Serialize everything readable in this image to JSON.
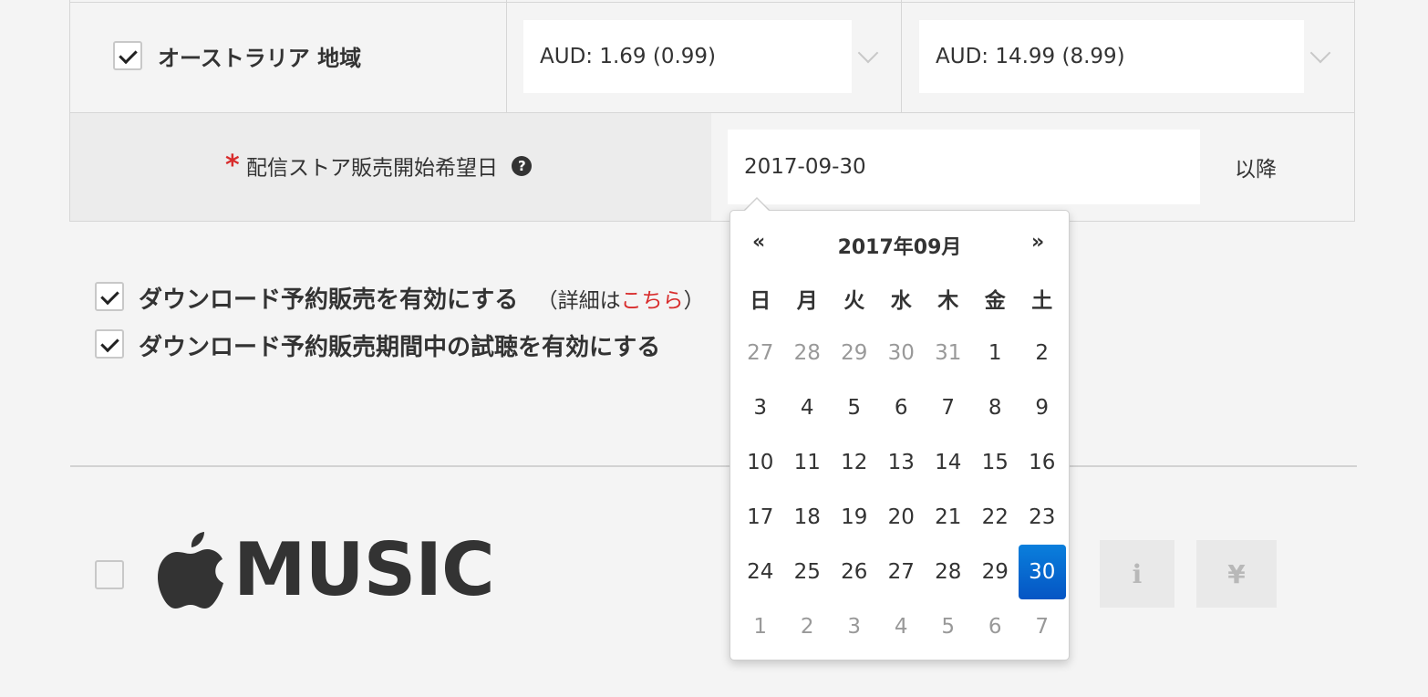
{
  "region_row": {
    "checked": true,
    "label": "オーストラリア 地域",
    "select1_value": "AUD: 1.69 (0.99)",
    "select2_value": "AUD: 14.99 (8.99)"
  },
  "release_date_row": {
    "required_mark": "*",
    "label": "配信ストア販売開始希望日",
    "help_icon_glyph": "?",
    "date_value": "2017-09-30",
    "suffix": "以降"
  },
  "preorder": {
    "option1_label": "ダウンロード予約販売を有効にする",
    "option1_note_prefix": "（詳細は",
    "option1_note_link": "こちら",
    "option1_note_suffix": "）",
    "option2_label": "ダウンロード予約販売期間中の試聴を有効にする"
  },
  "calendar": {
    "prev": "«",
    "next": "»",
    "title": "2017年09月",
    "weekdays": [
      "日",
      "月",
      "火",
      "水",
      "木",
      "金",
      "土"
    ],
    "weeks": [
      [
        "27",
        "28",
        "29",
        "30",
        "31",
        "1",
        "2"
      ],
      [
        "3",
        "4",
        "5",
        "6",
        "7",
        "8",
        "9"
      ],
      [
        "10",
        "11",
        "12",
        "13",
        "14",
        "15",
        "16"
      ],
      [
        "17",
        "18",
        "19",
        "20",
        "21",
        "22",
        "23"
      ],
      [
        "24",
        "25",
        "26",
        "27",
        "28",
        "29",
        "30"
      ],
      [
        "1",
        "2",
        "3",
        "4",
        "5",
        "6",
        "7"
      ]
    ],
    "selected": "30",
    "selected_color": "#0a6fd6"
  },
  "store": {
    "logo_text": "MUSIC",
    "info_button_glyph": "i",
    "price_button_glyph": "¥"
  },
  "colors": {
    "required": "#d82c2c",
    "link": "#d82c2c"
  }
}
